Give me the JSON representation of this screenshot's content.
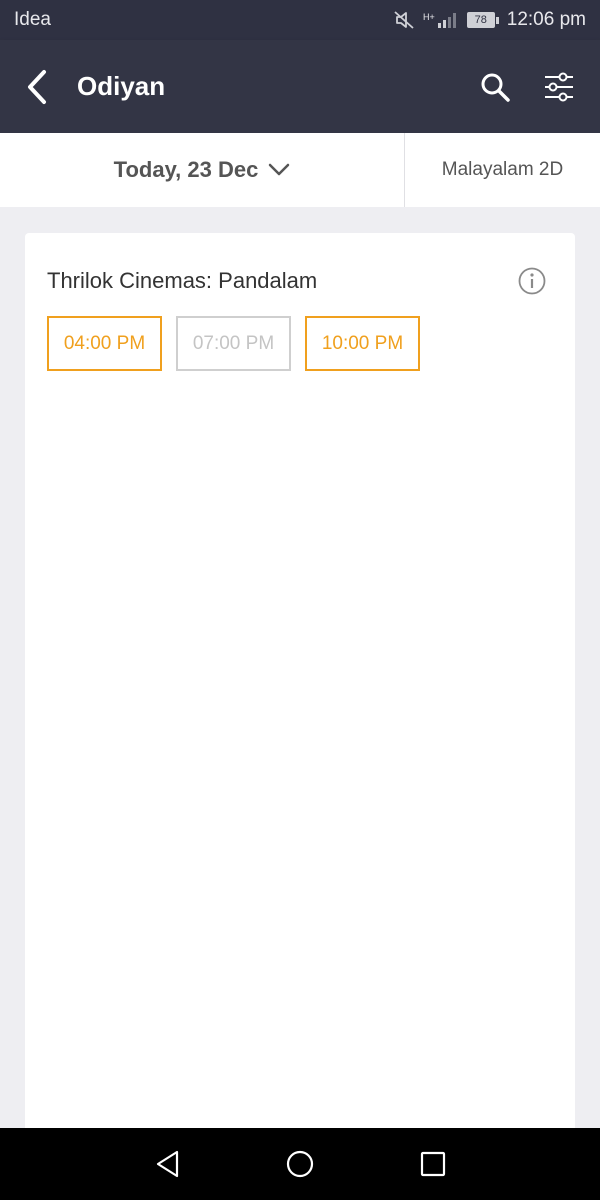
{
  "status_bar": {
    "carrier": "Idea",
    "network": "H+",
    "battery": "78",
    "time": "12:06 pm",
    "icons": [
      "mute-icon",
      "signal-icon",
      "battery-icon"
    ]
  },
  "app_bar": {
    "title": "Odiyan",
    "icons": [
      "back-arrow-icon",
      "search-icon",
      "filter-sliders-icon"
    ]
  },
  "selectors": {
    "date": "Today, 23 Dec",
    "format": "Malayalam 2D"
  },
  "cinema": {
    "name": "Thrilok Cinemas: Pandalam",
    "showtimes": [
      {
        "time": "04:00 PM",
        "available": true
      },
      {
        "time": "07:00 PM",
        "available": false
      },
      {
        "time": "10:00 PM",
        "available": true
      }
    ]
  },
  "colors": {
    "app_bar": "#333545",
    "accent": "#f0a01e",
    "disabled": "#c4c4c4",
    "background": "#eeeef2"
  },
  "nav_bar": {
    "icons": [
      "back-triangle-icon",
      "home-circle-icon",
      "recents-square-icon"
    ]
  }
}
